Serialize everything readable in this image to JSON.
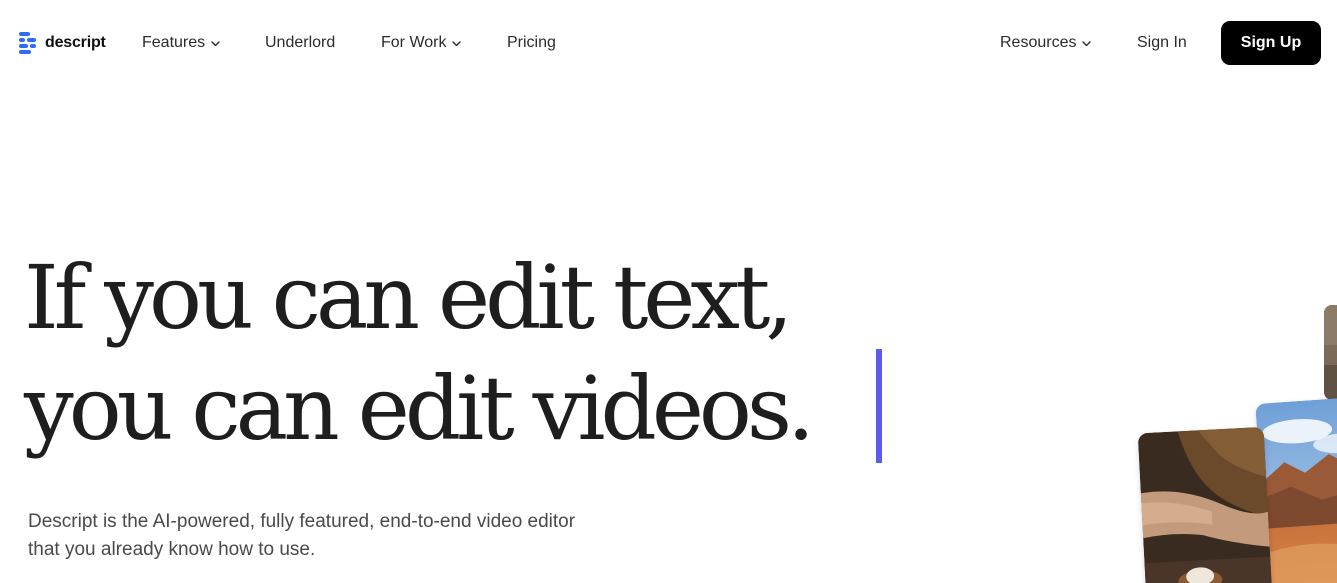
{
  "brand": {
    "name": "descript",
    "logo_color": "#2f6cf6"
  },
  "nav": {
    "items": [
      {
        "label": "Features",
        "has_dropdown": true
      },
      {
        "label": "Underlord",
        "has_dropdown": false
      },
      {
        "label": "For Work",
        "has_dropdown": true
      },
      {
        "label": "Pricing",
        "has_dropdown": false
      }
    ],
    "right": {
      "resources": {
        "label": "Resources",
        "has_dropdown": true
      },
      "sign_in": "Sign In",
      "sign_up": "Sign Up"
    }
  },
  "hero": {
    "headline_line1": "If you can edit text,",
    "headline_line2": "you can edit videos.",
    "caret_color": "#5b5bf0",
    "subtitle_line1": "Descript is the AI-powered, fully featured, end-to-end video editor",
    "subtitle_line2": "that you already know how to use."
  },
  "media_cards": [
    {
      "name": "video-thumbnail-hands"
    },
    {
      "name": "video-thumbnail-desert"
    },
    {
      "name": "video-thumbnail-partial"
    }
  ]
}
